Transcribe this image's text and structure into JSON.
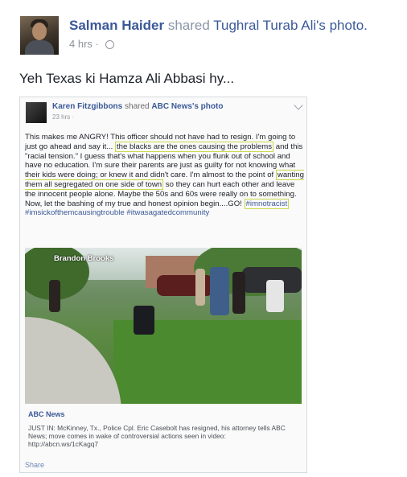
{
  "post": {
    "author_name": "Salman Haider",
    "shared_text": "shared",
    "original_owner": "Tughral Turab Ali's photo.",
    "time": "4 hrs",
    "separator": "·",
    "caption": "Yeh Texas ki Hamza Ali Abbasi hy..."
  },
  "shared_photo": {
    "author_name": "Karen Fitzgibbons",
    "shared_text": "shared",
    "shared_source": "ABC News's photo",
    "time": "23 hrs",
    "separator": "·",
    "text_parts": [
      "This makes me ANGRY! This officer should not have had to resign. I'm going to just go ahead and say it... ",
      "the blacks are the ones causing the problems",
      " and this \"racial tension.\" I guess that's what happens when you flunk out of school and have no education. I'm sure their parents are just as guilty for not knowing what their kids were doing; or knew it and didn't care. I'm almost to the point of ",
      "wanting them all segregated on one side of town",
      " so they can hurt each other and leave the innocent people alone. Maybe the 50s and 60s were really on to something. Now, let the bashing of my true and honest opinion begin....GO! ",
      "#imnotracist",
      " #imsickofthemcausingtrouble #itwasagatedcommunity"
    ],
    "photo_watermark": "Brandon Brooks",
    "link_source": "ABC News",
    "link_description": "JUST IN: McKinney, Tx., Police Cpl. Eric Casebolt has resigned, his attorney tells ABC News; move comes in wake of controversial actions seen in video: http://abcn.ws/1cKagq7",
    "share_label": "Share"
  },
  "icons": [
    "globe-icon",
    "chevron-down-icon"
  ]
}
